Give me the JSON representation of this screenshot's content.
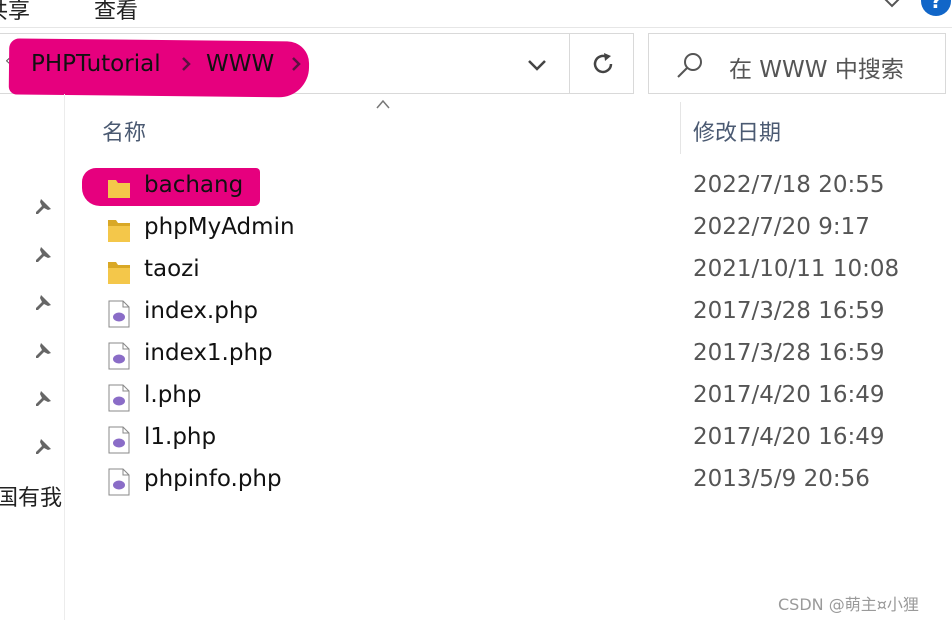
{
  "ribbon": {
    "tab_share": "共享",
    "tab_view": "查看",
    "help": "?"
  },
  "address": {
    "crumbs": [
      "PHPTutorial",
      "WWW"
    ],
    "highlight_color": "#e6007e"
  },
  "search": {
    "placeholder": "在 WWW 中搜索"
  },
  "columns": {
    "name": "名称",
    "date_modified": "修改日期"
  },
  "files": [
    {
      "name": "bachang",
      "type": "folder",
      "date": "2022/7/18 20:55",
      "highlighted": true
    },
    {
      "name": "phpMyAdmin",
      "type": "folder",
      "date": "2022/7/20 9:17"
    },
    {
      "name": "taozi",
      "type": "folder",
      "date": "2021/10/11 10:08"
    },
    {
      "name": "index.php",
      "type": "php-file",
      "date": "2017/3/28 16:59"
    },
    {
      "name": "index1.php",
      "type": "php-file",
      "date": "2017/3/28 16:59"
    },
    {
      "name": "l.php",
      "type": "php-file",
      "date": "2017/4/20 16:49"
    },
    {
      "name": "l1.php",
      "type": "php-file",
      "date": "2017/4/20 16:49"
    },
    {
      "name": "phpinfo.php",
      "type": "php-file",
      "date": "2013/5/9 20:56"
    }
  ],
  "nav_pane": {
    "pin_icons": 6,
    "partial_text": "国有我"
  },
  "watermark": "CSDN @萌主¤小狸",
  "colors": {
    "folder": "#f4c74a",
    "php_elephant": "#8a6cc7",
    "help_blue": "#1166c8"
  }
}
